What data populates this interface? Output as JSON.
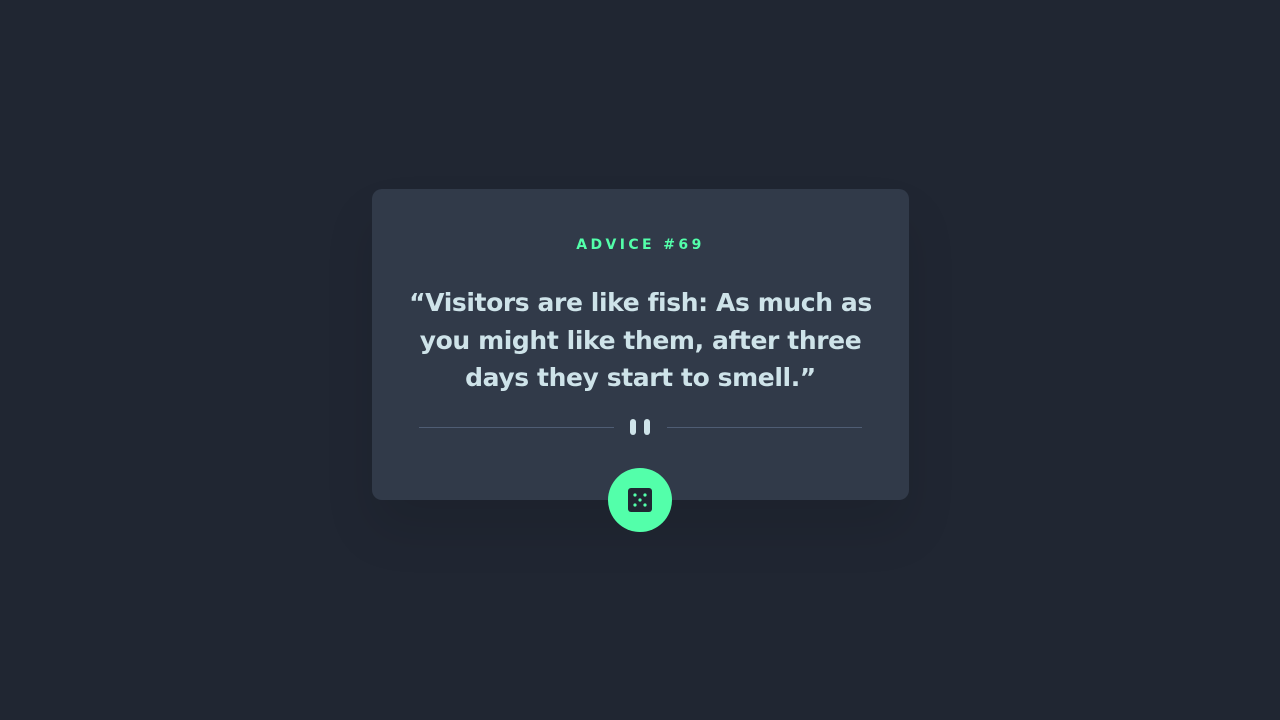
{
  "advice": {
    "label": "ADVICE #69",
    "quote": "“Visitors are like fish: As much as you might like them, after three days they start to smell.”"
  },
  "controls": {
    "dice_icon": "dice-icon",
    "pause_icon": "pause-icon"
  },
  "colors": {
    "background": "#202632",
    "card": "#313a49",
    "accent": "#53ffaa",
    "text": "#cee3e9",
    "divider": "#4f5d74"
  }
}
